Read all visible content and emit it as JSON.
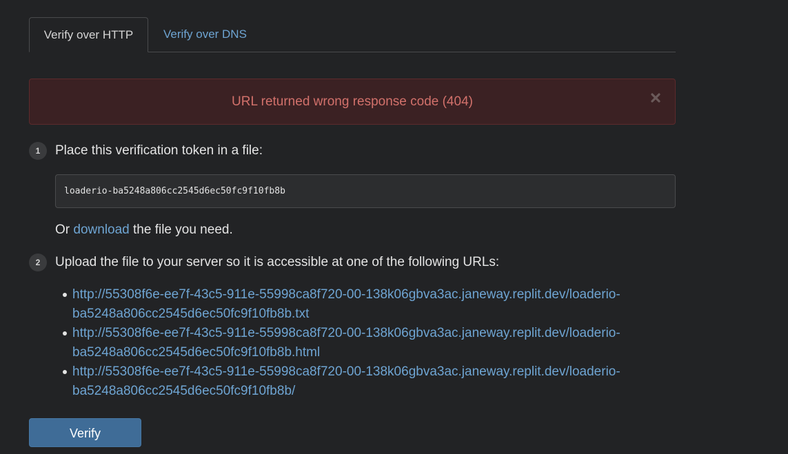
{
  "tabs": [
    {
      "label": "Verify over HTTP",
      "active": true
    },
    {
      "label": "Verify over DNS",
      "active": false
    }
  ],
  "alert": {
    "message": "URL returned wrong response code (404)",
    "close_icon": "close-icon"
  },
  "steps": [
    {
      "number": "1",
      "text": "Place this verification token in a file:",
      "token": "loaderio-ba5248a806cc2545d6ec50fc9f10fb8b",
      "or_prefix": "Or",
      "download_link": "download",
      "or_suffix": "the file you need."
    },
    {
      "number": "2",
      "text": "Upload the file to your server so it is accessible at one of the following URLs:",
      "urls": [
        {
          "line1": "http://55308f6e-ee7f-43c5-911e-55998ca8f720-00-138k06gbva3ac.janeway.replit.dev/loaderio-",
          "line2": "ba5248a806cc2545d6ec50fc9f10fb8b.txt"
        },
        {
          "line1": "http://55308f6e-ee7f-43c5-911e-55998ca8f720-00-138k06gbva3ac.janeway.replit.dev/loaderio-",
          "line2": "ba5248a806cc2545d6ec50fc9f10fb8b.html"
        },
        {
          "line1": "http://55308f6e-ee7f-43c5-911e-55998ca8f720-00-138k06gbva3ac.janeway.replit.dev/loaderio-",
          "line2": "ba5248a806cc2545d6ec50fc9f10fb8b/"
        }
      ]
    }
  ],
  "verify_button": {
    "label": "Verify"
  },
  "colors": {
    "background": "#222325",
    "link": "#6ea4d2",
    "alert_text": "#d2716b",
    "alert_bg": "#3b2123",
    "button_bg": "#3f6c97"
  }
}
